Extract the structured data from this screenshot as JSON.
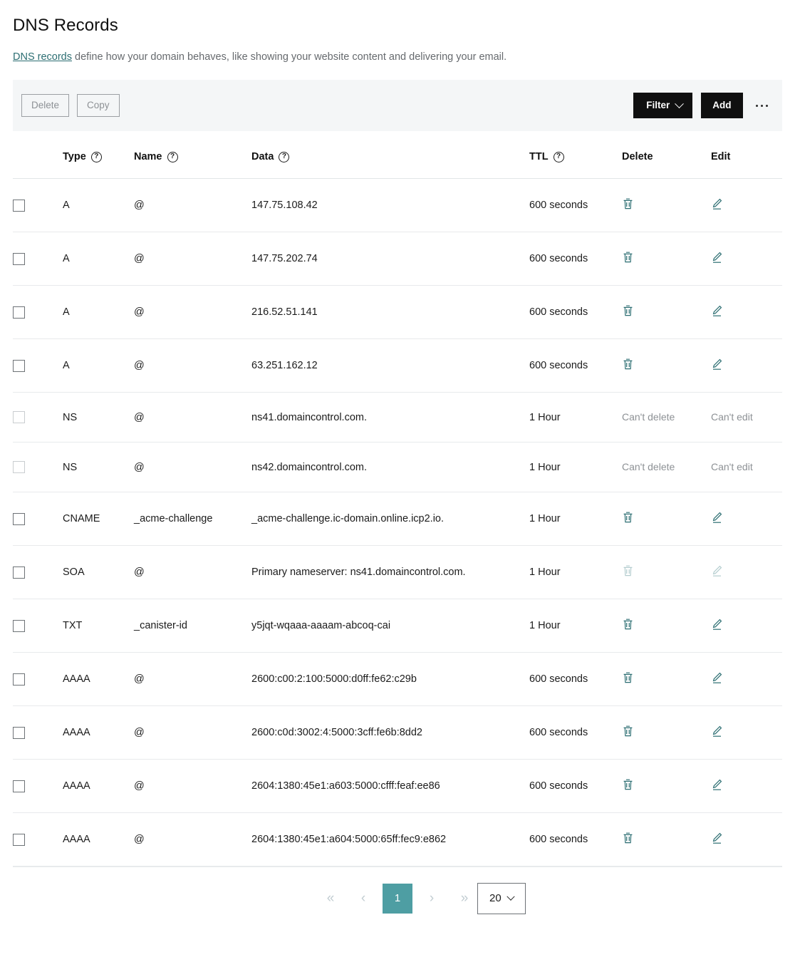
{
  "header": {
    "title": "DNS Records",
    "description_link": "DNS records",
    "description_rest": " define how your domain behaves, like showing your website content and delivering your email."
  },
  "toolbar": {
    "delete_label": "Delete",
    "copy_label": "Copy",
    "filter_label": "Filter",
    "add_label": "Add",
    "more_label": "•••"
  },
  "table": {
    "columns": [
      {
        "key": "type",
        "label": "Type",
        "help": "?"
      },
      {
        "key": "name",
        "label": "Name",
        "help": "?"
      },
      {
        "key": "data",
        "label": "Data",
        "help": "?"
      },
      {
        "key": "ttl",
        "label": "TTL",
        "help": "?"
      },
      {
        "key": "delete",
        "label": "Delete",
        "help": ""
      },
      {
        "key": "edit",
        "label": "Edit",
        "help": ""
      }
    ],
    "cant_delete_label": "Can't delete",
    "cant_edit_label": "Can't edit",
    "rows": [
      {
        "type": "A",
        "name": "@",
        "data": "147.75.108.42",
        "ttl": "600 seconds",
        "delete": "icon",
        "edit": "icon"
      },
      {
        "type": "A",
        "name": "@",
        "data": "147.75.202.74",
        "ttl": "600 seconds",
        "delete": "icon",
        "edit": "icon"
      },
      {
        "type": "A",
        "name": "@",
        "data": "216.52.51.141",
        "ttl": "600 seconds",
        "delete": "icon",
        "edit": "icon"
      },
      {
        "type": "A",
        "name": "@",
        "data": "63.251.162.12",
        "ttl": "600 seconds",
        "delete": "icon",
        "edit": "icon"
      },
      {
        "type": "NS",
        "name": "@",
        "data": "ns41.domaincontrol.com.",
        "ttl": "1 Hour",
        "delete": "text",
        "edit": "text"
      },
      {
        "type": "NS",
        "name": "@",
        "data": "ns42.domaincontrol.com.",
        "ttl": "1 Hour",
        "delete": "text",
        "edit": "text"
      },
      {
        "type": "CNAME",
        "name": "_acme-challenge",
        "data": "_acme-challenge.ic-domain.online.icp2.io.",
        "ttl": "1 Hour",
        "delete": "icon",
        "edit": "icon"
      },
      {
        "type": "SOA",
        "name": "@",
        "data": "Primary nameserver: ns41.domaincontrol.com.",
        "ttl": "1 Hour",
        "delete": "icon-disabled",
        "edit": "icon-disabled"
      },
      {
        "type": "TXT",
        "name": "_canister-id",
        "data": "y5jqt-wqaaa-aaaam-abcoq-cai",
        "ttl": "1 Hour",
        "delete": "icon",
        "edit": "icon"
      },
      {
        "type": "AAAA",
        "name": "@",
        "data": "2600:c00:2:100:5000:d0ff:fe62:c29b",
        "ttl": "600 seconds",
        "delete": "icon",
        "edit": "icon"
      },
      {
        "type": "AAAA",
        "name": "@",
        "data": "2600:c0d:3002:4:5000:3cff:fe6b:8dd2",
        "ttl": "600 seconds",
        "delete": "icon",
        "edit": "icon"
      },
      {
        "type": "AAAA",
        "name": "@",
        "data": "2604:1380:45e1:a603:5000:cfff:feaf:ee86",
        "ttl": "600 seconds",
        "delete": "icon",
        "edit": "icon"
      },
      {
        "type": "AAAA",
        "name": "@",
        "data": "2604:1380:45e1:a604:5000:65ff:fec9:e862",
        "ttl": "600 seconds",
        "delete": "icon",
        "edit": "icon"
      }
    ]
  },
  "pagination": {
    "first_label": "«",
    "prev_label": "‹",
    "current_page": "1",
    "next_label": "›",
    "last_label": "»",
    "page_size": "20"
  },
  "colors": {
    "accent_teal": "#4e9ea3",
    "icon_teal": "#2c6e72",
    "toolbar_bg": "#f4f6f7",
    "button_dark": "#101010"
  }
}
